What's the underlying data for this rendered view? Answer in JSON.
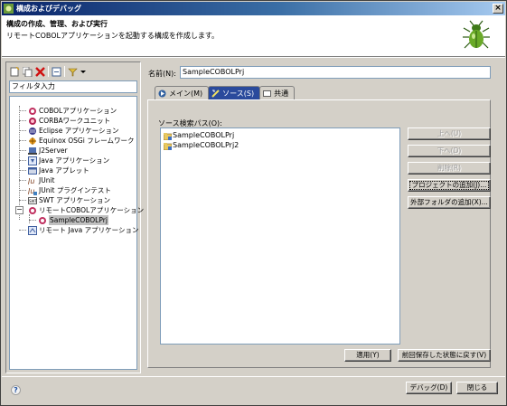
{
  "window": {
    "title": "構成およびデバッグ"
  },
  "header": {
    "title": "構成の作成、管理、および実行",
    "description": "リモートCOBOLアプリケーションを起動する構成を作成します。"
  },
  "left": {
    "filter_placeholder": "フィルタ入力",
    "tree": [
      {
        "label": "COBOLアプリケーション",
        "icon": "cobol-app-icon"
      },
      {
        "label": "CORBAワークユニット",
        "icon": "corba-icon"
      },
      {
        "label": "Eclipse アプリケーション",
        "icon": "eclipse-icon"
      },
      {
        "label": "Equinox OSGi フレームワーク",
        "icon": "osgi-icon"
      },
      {
        "label": "J2Server",
        "icon": "server-icon"
      },
      {
        "label": "Java アプリケーション",
        "icon": "java-app-icon"
      },
      {
        "label": "Java アプレット",
        "icon": "applet-icon"
      },
      {
        "label": "JUnit",
        "icon": "junit-icon"
      },
      {
        "label": "JUnit プラグインテスト",
        "icon": "junit-plugin-icon"
      },
      {
        "label": "SWT アプリケーション",
        "icon": "swt-icon"
      },
      {
        "label": "リモートCOBOLアプリケーション",
        "icon": "remote-cobol-icon"
      },
      {
        "label": "SampleCOBOLPrj",
        "icon": "config-icon"
      },
      {
        "label": "リモート Java アプリケーション",
        "icon": "remote-java-icon"
      }
    ]
  },
  "right": {
    "name_label": "名前(N):",
    "name_value": "SampleCOBOLPrj",
    "tabs": [
      {
        "label": "メイン(M)",
        "icon": "main-tab-icon"
      },
      {
        "label": "ソース(S)",
        "icon": "source-tab-icon"
      },
      {
        "label": "共通",
        "icon": "common-tab-icon"
      }
    ],
    "source_path_label": "ソース検索パス(O):",
    "source_items": [
      "SampleCOBOLPrj",
      "SampleCOBOLPrj2"
    ],
    "buttons": {
      "up": "上へ(U)",
      "down": "下へ(D)",
      "remove": "削除(R)",
      "add_project": "プロジェクトの追加(J)...",
      "add_external_folder": "外部フォルダの追加(X)..."
    },
    "apply": "適用(Y)",
    "revert": "前回保存した状態に戻す(V)"
  },
  "footer": {
    "help": "?",
    "debug": "デバッグ(D)",
    "close": "閉じる"
  },
  "colors": {
    "title_start": "#0a246a",
    "title_end": "#a6caf0",
    "active_tab": "#2a4a9c",
    "face": "#d4d0c8"
  }
}
